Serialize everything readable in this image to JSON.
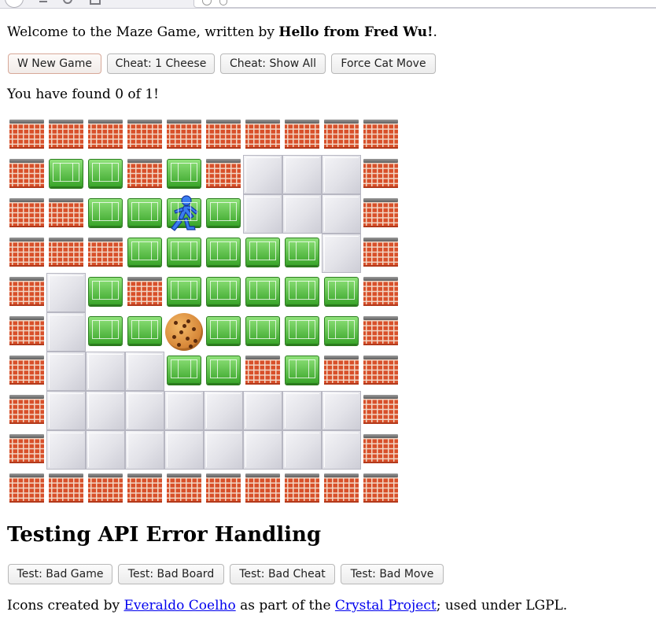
{
  "welcome": {
    "prefix": "Welcome to the Maze Game, written by ",
    "author": "Hello from Fred Wu!",
    "suffix": "."
  },
  "game_buttons": {
    "new_game": "W New Game",
    "cheat_one": "Cheat: 1 Cheese",
    "cheat_all": "Cheat: Show All",
    "force_cat": "Force Cat Move"
  },
  "status": "You have found 0 of 1!",
  "board": {
    "rows": 10,
    "cols": 10,
    "legend": {
      "W": "brick-wall",
      "F": "green-floor",
      "G": "grey-revealed",
      "P": "player",
      "C": "cheese-cookie"
    },
    "grid": [
      "WWWWWWWWWW",
      "WFFWFWGGGW",
      "WWFFPFGGGW",
      "WWWFFFFFGW",
      "WGFWFFFFFW",
      "WGFFCFFFFW",
      "WGGGFFWFWW",
      "WGGGGGGGGW",
      "WGGGGGGGGW",
      "WWWWWWWWWW"
    ]
  },
  "api_heading": "Testing API Error Handling",
  "api_buttons": {
    "bad_game": "Test: Bad Game",
    "bad_board": "Test: Bad Board",
    "bad_cheat": "Test: Bad Cheat",
    "bad_move": "Test: Bad Move"
  },
  "footer": {
    "prefix": "Icons created by ",
    "link1": "Everaldo Coelho",
    "middle": " as part of the ",
    "link2": "Crystal Project",
    "suffix": "; used under LGPL."
  },
  "icons": {
    "player": "runner-icon",
    "cheese": "cookie-icon",
    "wall": "brick-wall-icon",
    "floor": "green-floor-icon",
    "revealed": "grey-block-icon"
  }
}
